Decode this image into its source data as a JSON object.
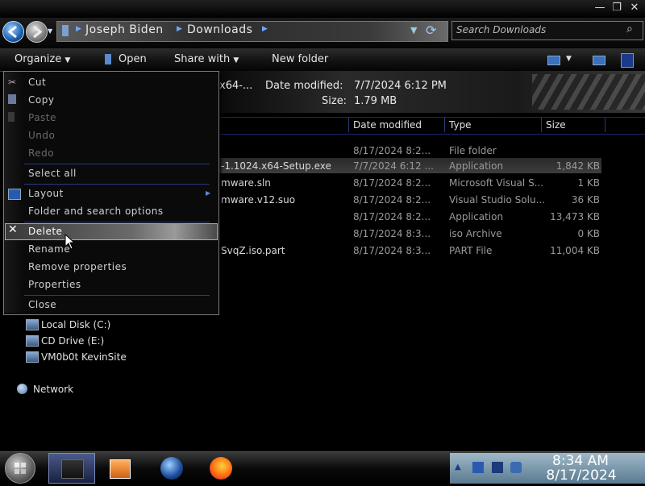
{
  "window": {
    "controls": {
      "minimize": "—",
      "restore": "❐",
      "close": "✕"
    }
  },
  "address": {
    "crumbs": [
      "Joseph Biden",
      "Downloads"
    ],
    "search_placeholder": "Search Downloads"
  },
  "toolbar": {
    "organize": "Organize",
    "open": "Open",
    "share_with": "Share with",
    "new_folder": "New folder"
  },
  "details": {
    "name_partial": "x64-...",
    "date_modified_label": "Date modified:",
    "date_modified_value": "7/7/2024 6:12 PM",
    "size_label": "Size:",
    "size_value": "1.79 MB"
  },
  "columns": {
    "date": "Date modified",
    "type": "Type",
    "size": "Size"
  },
  "files": [
    {
      "name": "",
      "date": "8/17/2024 8:2...",
      "type": "File folder",
      "size": ""
    },
    {
      "name": "-1.1024.x64-Setup.exe",
      "date": "7/7/2024 6:12 ...",
      "type": "Application",
      "size": "1,842 KB"
    },
    {
      "name": "mware.sln",
      "date": "8/17/2024 8:2...",
      "type": "Microsoft Visual S...",
      "size": "1 KB"
    },
    {
      "name": "mware.v12.suo",
      "date": "8/17/2024 8:2...",
      "type": "Visual Studio Solu...",
      "size": "36 KB"
    },
    {
      "name": "",
      "date": "8/17/2024 8:2...",
      "type": "Application",
      "size": "13,473 KB"
    },
    {
      "name": "",
      "date": "8/17/2024 8:3...",
      "type": "iso Archive",
      "size": "0 KB"
    },
    {
      "name": "SvqZ.iso.part",
      "date": "8/17/2024 8:3...",
      "type": "PART File",
      "size": "11,004 KB"
    }
  ],
  "nav": {
    "local_disk": "Local Disk (C:)",
    "cd_drive": "CD Drive (E:)",
    "vm": "VM0b0t KevinSite",
    "network": "Network"
  },
  "menu": {
    "cut": "Cut",
    "copy": "Copy",
    "paste": "Paste",
    "undo": "Undo",
    "redo": "Redo",
    "select_all": "Select all",
    "layout": "Layout",
    "folder_options": "Folder and search options",
    "delete": "Delete",
    "rename": "Rename",
    "remove_properties": "Remove properties",
    "properties": "Properties",
    "close": "Close"
  },
  "clock": {
    "time": "8:34 AM",
    "date": "8/17/2024"
  },
  "colors": {
    "accent": "#2a3a7a",
    "highlight": "#6a6a6a",
    "tray": "#7a98ac"
  }
}
